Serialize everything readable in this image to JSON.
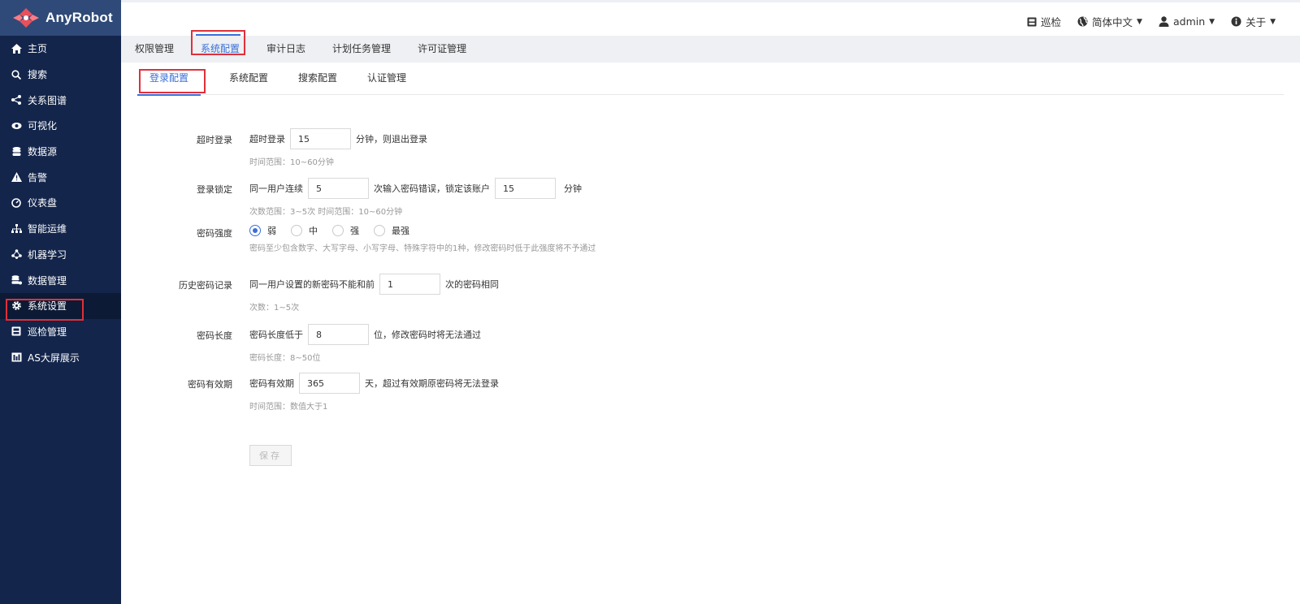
{
  "app": {
    "name": "AnyRobot"
  },
  "colors": {
    "sidebar_bg": "#13254b",
    "logo_bg": "#2f4a78",
    "accent": "#3a6fd8",
    "highlight_box": "#e0303a"
  },
  "sidebar": {
    "items": [
      {
        "label": "主页",
        "icon": "home-icon"
      },
      {
        "label": "搜索",
        "icon": "search-icon"
      },
      {
        "label": "关系图谱",
        "icon": "graph-icon"
      },
      {
        "label": "可视化",
        "icon": "eye-icon"
      },
      {
        "label": "数据源",
        "icon": "database-icon"
      },
      {
        "label": "告警",
        "icon": "warning-icon"
      },
      {
        "label": "仪表盘",
        "icon": "dashboard-icon"
      },
      {
        "label": "智能运维",
        "icon": "sitemap-icon"
      },
      {
        "label": "机器学习",
        "icon": "ml-icon"
      },
      {
        "label": "数据管理",
        "icon": "data-manage-icon"
      },
      {
        "label": "系统设置",
        "icon": "gear-icon",
        "active": true
      },
      {
        "label": "巡检管理",
        "icon": "inspect-icon"
      },
      {
        "label": "AS大屏展示",
        "icon": "bar-chart-icon"
      }
    ]
  },
  "header": {
    "inspect": "巡检",
    "language": "简体中文",
    "user": "admin",
    "about": "关于"
  },
  "tabs": [
    "权限管理",
    "系统配置",
    "审计日志",
    "计划任务管理",
    "许可证管理"
  ],
  "subtabs": [
    "登录配置",
    "系统配置",
    "搜索配置",
    "认证管理"
  ],
  "form": {
    "timeout": {
      "label": "超时登录",
      "prefix": "超时登录",
      "value": "15",
      "suffix": "分钟，则退出登录",
      "hint": "时间范围：10~60分钟"
    },
    "lockout": {
      "label": "登录锁定",
      "prefix": "同一用户连续",
      "attempts": "5",
      "middle": "次输入密码错误，锁定该账户",
      "minutes": "15",
      "suffix": "分钟",
      "hint": "次数范围：3~5次  时间范围：10~60分钟"
    },
    "strength": {
      "label": "密码强度",
      "options": [
        "弱",
        "中",
        "强",
        "最强"
      ],
      "selected": "弱",
      "hint": "密码至少包含数字、大写字母、小写字母、特殊字符中的1种，修改密码时低于此强度将不予通过"
    },
    "history": {
      "label": "历史密码记录",
      "prefix": "同一用户设置的新密码不能和前",
      "value": "1",
      "suffix": "次的密码相同",
      "hint": "次数：1~5次"
    },
    "length": {
      "label": "密码长度",
      "prefix": "密码长度低于",
      "value": "8",
      "suffix": "位，修改密码时将无法通过",
      "hint": "密码长度：8~50位"
    },
    "validity": {
      "label": "密码有效期",
      "prefix": "密码有效期",
      "value": "365",
      "suffix": "天，超过有效期原密码将无法登录",
      "hint": "时间范围：数值大于1"
    },
    "save_label": "保存"
  }
}
